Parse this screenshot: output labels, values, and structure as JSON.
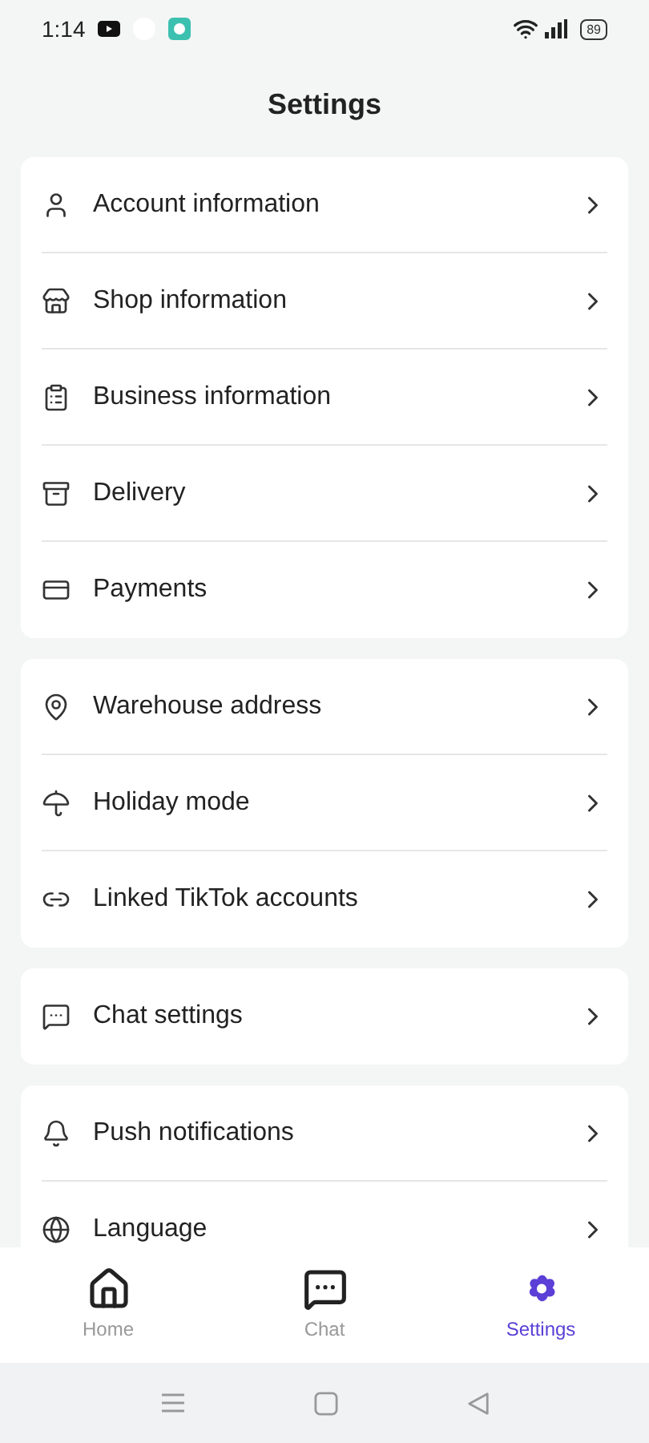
{
  "status_bar": {
    "time": "1:14",
    "battery": "89"
  },
  "header": {
    "title": "Settings"
  },
  "groups": [
    {
      "items": [
        {
          "label": "Account information"
        },
        {
          "label": "Shop information"
        },
        {
          "label": "Business information"
        },
        {
          "label": "Delivery"
        },
        {
          "label": "Payments"
        }
      ]
    },
    {
      "items": [
        {
          "label": "Warehouse address"
        },
        {
          "label": "Holiday mode"
        },
        {
          "label": "Linked TikTok accounts"
        }
      ]
    },
    {
      "items": [
        {
          "label": "Chat settings"
        }
      ]
    },
    {
      "items": [
        {
          "label": "Push notifications"
        },
        {
          "label": "Language"
        }
      ]
    }
  ],
  "bottom_nav": [
    {
      "label": "Home",
      "selected": false
    },
    {
      "label": "Chat",
      "selected": false
    },
    {
      "label": "Settings",
      "selected": true
    }
  ]
}
